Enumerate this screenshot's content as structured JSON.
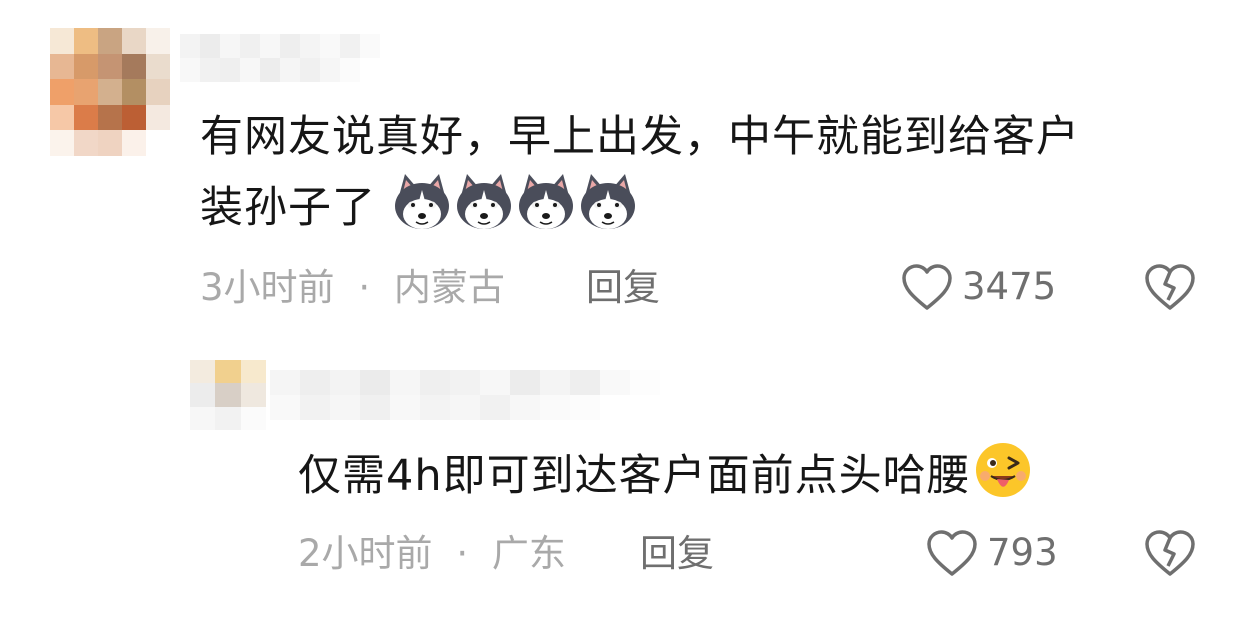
{
  "comments": [
    {
      "text_line1": "有网友说真好，早上出发，中午就能到给客户",
      "text_line2": "装孙子了",
      "emoji_name": "husky-dog-emoji",
      "emoji_count": 4,
      "time": "3小时前",
      "dot": "·",
      "location": "内蒙古",
      "reply_label": "回复",
      "likes": "3475"
    },
    {
      "text": "仅需4h即可到达客户面前点头哈腰",
      "emoji_name": "wink-tongue-emoji",
      "time": "2小时前",
      "dot": "·",
      "location": "广东",
      "reply_label": "回复",
      "likes": "793"
    }
  ]
}
